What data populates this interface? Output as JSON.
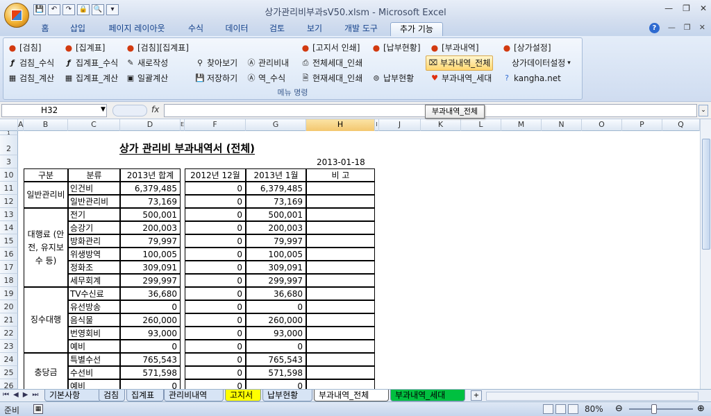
{
  "window": {
    "title": "상가관리비부과sV50.xlsm  -  Microsoft Excel",
    "controls": [
      "—",
      "❐",
      "✕"
    ]
  },
  "quick_access": [
    "💾",
    "↶",
    "↷",
    "🔒",
    "🔍",
    "▾"
  ],
  "ribbon_tabs": [
    "홈",
    "삽입",
    "페이지 레이아웃",
    "수식",
    "데이터",
    "검토",
    "보기",
    "개발 도구",
    "추가 기능"
  ],
  "active_tab": "추가 기능",
  "ribbon_controls": [
    "?",
    "—",
    "❐",
    "✕"
  ],
  "menu": {
    "group_label": "메뉴 명령",
    "row1": [
      "[검침]",
      "[집계표]",
      "[검침][집계표]",
      "[고지서 인쇄]",
      "[납부현황]",
      "[부과내역]",
      "[상가설정]"
    ],
    "row2": [
      "검침_수식",
      "집계표_수식",
      "새로작성",
      "찾아보기",
      "관리비내",
      "전체세대_인쇄",
      "부과내역_전체",
      "상가데이터설정"
    ],
    "row3": [
      "검침_계산",
      "집계표_계산",
      "일괄계산",
      "저장하기",
      "역_수식",
      "현재세대_인쇄",
      "납부현황",
      "부과내역_세대",
      "kangha.net"
    ]
  },
  "tooltip": "부과내역_전체",
  "formula_bar": {
    "name_box": "H32",
    "fx": "fx",
    "formula": ""
  },
  "columns": [
    "A",
    "B",
    "C",
    "D",
    "E",
    "F",
    "G",
    "H",
    "I",
    "J",
    "K",
    "L",
    "M",
    "N",
    "O",
    "P",
    "Q"
  ],
  "selected_column": "H",
  "row_numbers": [
    "1",
    "2",
    "3",
    "10",
    "11",
    "12",
    "13",
    "14",
    "15",
    "16",
    "17",
    "18",
    "19",
    "20",
    "21",
    "22",
    "23",
    "24",
    "25",
    "26"
  ],
  "sheet": {
    "title": "상가 관리비 부과내역서 (전체)",
    "date": "2013-01-18",
    "headers": {
      "gubun": "구분",
      "bunryu": "분류",
      "total": "2013년 합계",
      "prev": "2012년 12월",
      "curr": "2013년 1월",
      "note": "비    고"
    },
    "groups": [
      {
        "name": "일반관리비",
        "items": [
          {
            "name": "인건비",
            "total": "6,379,485",
            "prev": "0",
            "curr": "6,379,485"
          },
          {
            "name": "일반관리비",
            "total": "73,169",
            "prev": "0",
            "curr": "73,169"
          }
        ]
      },
      {
        "name": "대행료 (안전, 유지보수 등)",
        "items": [
          {
            "name": "전기",
            "total": "500,001",
            "prev": "0",
            "curr": "500,001"
          },
          {
            "name": "승강기",
            "total": "200,003",
            "prev": "0",
            "curr": "200,003"
          },
          {
            "name": "방화관리",
            "total": "79,997",
            "prev": "0",
            "curr": "79,997"
          },
          {
            "name": "위생방역",
            "total": "100,005",
            "prev": "0",
            "curr": "100,005"
          },
          {
            "name": "정화조",
            "total": "309,091",
            "prev": "0",
            "curr": "309,091"
          },
          {
            "name": "세무회계",
            "total": "299,997",
            "prev": "0",
            "curr": "299,997"
          }
        ]
      },
      {
        "name": "징수대행",
        "items": [
          {
            "name": "TV수신료",
            "total": "36,680",
            "prev": "0",
            "curr": "36,680"
          },
          {
            "name": "유선방송",
            "total": "0",
            "prev": "0",
            "curr": "0"
          },
          {
            "name": "음식물",
            "total": "260,000",
            "prev": "0",
            "curr": "260,000"
          },
          {
            "name": "번영회비",
            "total": "93,000",
            "prev": "0",
            "curr": "93,000"
          },
          {
            "name": "예비",
            "total": "0",
            "prev": "0",
            "curr": "0"
          }
        ]
      },
      {
        "name": "충당금",
        "items": [
          {
            "name": "특별수선",
            "total": "765,543",
            "prev": "0",
            "curr": "765,543"
          },
          {
            "name": "수선비",
            "total": "571,598",
            "prev": "0",
            "curr": "571,598"
          },
          {
            "name": "예비",
            "total": "0",
            "prev": "0",
            "curr": "0"
          }
        ]
      }
    ]
  },
  "sheet_tabs": [
    {
      "label": "기본사항",
      "bg": "#d7e4f5"
    },
    {
      "label": "검침",
      "bg": "#d7e4f5"
    },
    {
      "label": "집계표",
      "bg": "#d7e4f5"
    },
    {
      "label": "관리비내역",
      "bg": "#d7e4f5"
    },
    {
      "label": "고지서",
      "bg": "#ffff00"
    },
    {
      "label": "납부현황",
      "bg": "#d7e4f5"
    },
    {
      "label": "부과내역_전체",
      "bg": "#ffffff"
    },
    {
      "label": "부과내역_세대",
      "bg": "#00c040"
    }
  ],
  "active_sheet": "부과내역_전체",
  "status": {
    "mode": "준비",
    "zoom": "80%"
  }
}
